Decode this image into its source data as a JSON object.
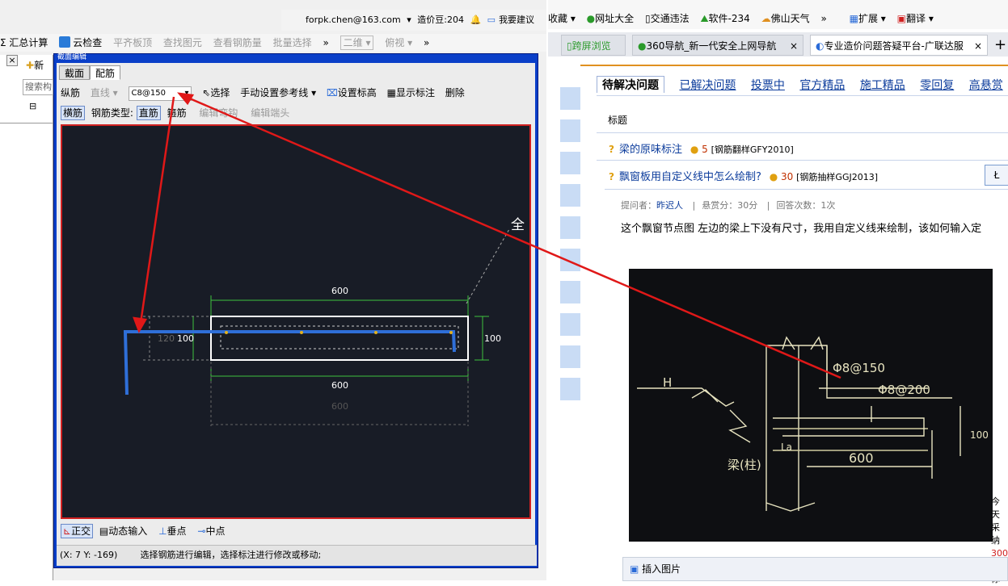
{
  "left_app": {
    "account": {
      "email": "forpk.chen@163.com",
      "dropdown": "▾",
      "beans": "造价豆:204",
      "suggest": "我要建议"
    },
    "toolbar": [
      {
        "label": "Σ 汇总计算",
        "enabled": true
      },
      {
        "label": "云检查",
        "enabled": true
      },
      {
        "label": "平齐板顶",
        "enabled": false
      },
      {
        "label": "查找图元",
        "enabled": false
      },
      {
        "label": "查看钢筋量",
        "enabled": false
      },
      {
        "label": "批量选择",
        "enabled": false
      },
      {
        "label": "»",
        "enabled": true
      },
      {
        "label": "二维 ▾",
        "enabled": false
      },
      {
        "label": "俯视 ▾",
        "enabled": false
      },
      {
        "label": "»",
        "enabled": true
      }
    ],
    "sidebar": {
      "close": "×",
      "new_label": "新",
      "search_label": "搜索构",
      "tree_toggle": "⊟"
    },
    "dialog": {
      "title": "截面编辑",
      "tabs": [
        "截面",
        "配筋"
      ],
      "row1": {
        "longitudinal": "纵筋",
        "straight": "直线 ▾",
        "combo_value": "C8@150",
        "select": "选择",
        "manual_ref": "手动设置参考线 ▾",
        "set_elevation": "设置标高",
        "show_label": "显示标注",
        "delete": "删除"
      },
      "row2": {
        "transverse": "横筋",
        "type_label": "钢筋类型:",
        "straight_bar": "直筋",
        "stirrup": "箍筋",
        "edit_bend": "编辑弯钩",
        "edit_end": "编辑端头"
      },
      "canvas": {
        "dim_top": "600",
        "dim_mid": "600",
        "dim_bottom": "600",
        "dim_left_outer": "120",
        "dim_left_inner": "100",
        "dim_right": "100",
        "full_label": "全"
      },
      "bottom": {
        "ortho": "正交",
        "dynamic": "动态输入",
        "perp": "垂点",
        "mid": "中点"
      },
      "status": {
        "coords": "(X: 7 Y: -169)",
        "hint": "选择钢筋进行编辑，选择标注进行修改或移动;"
      }
    }
  },
  "browser": {
    "bookmarks": [
      "收藏 ▾",
      "网址大全",
      "交通违法",
      "软件-234",
      "佛山天气",
      "»",
      "扩展 ▾",
      "翻译 ▾"
    ],
    "tabs": [
      {
        "label": "跨屏浏览",
        "active": false
      },
      {
        "label": "360导航_新一代安全上网导航",
        "active": false
      },
      {
        "label": "专业造价问题答疑平台-广联达服",
        "active": true
      }
    ],
    "new_tab": "+",
    "close_tab": "×",
    "question_tabs": [
      "待解决问题",
      "已解决问题",
      "投票中",
      "官方精品",
      "施工精品",
      "零回复",
      "高悬赏"
    ],
    "column_title": "标题",
    "questions": [
      {
        "title": "梁的原味标注",
        "points": "5",
        "tag": "[钢筋翻样GFY2010]"
      },
      {
        "title": "飘窗板用自定义线中怎么绘制?",
        "points": "30",
        "tag": "[钢筋抽样GGJ2013]"
      }
    ],
    "meta": {
      "asker_label": "提问者：",
      "asker": "昨迟人",
      "reward": "悬赏分：30分",
      "answers": "回答次数：1次"
    },
    "question_text": "这个飘窗节点图 左边的梁上下没有尺寸，我用自定义线来绘制，该如何输入定",
    "photo_labels": {
      "rebar1": "Φ8@150",
      "rebar2": "Φ8@200",
      "h": "H",
      "beam": "梁(柱)",
      "la": "La",
      "dim": "600",
      "dim_v": "100"
    },
    "insert_image": "插入图片",
    "side_text": [
      "今天",
      "采纳",
      "300",
      "你"
    ],
    "side_button": "Ł"
  }
}
